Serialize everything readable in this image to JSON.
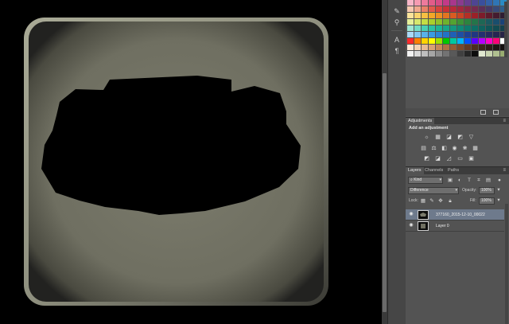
{
  "tools": [
    {
      "icon": "brush-icon",
      "glyph": "✎"
    },
    {
      "icon": "clone-stamp-icon",
      "glyph": "⚲"
    },
    {
      "icon": "text-icon",
      "glyph": "A"
    },
    {
      "icon": "paragraph-icon",
      "glyph": "¶"
    }
  ],
  "swatches": {
    "colors": [
      "#f7b6c8",
      "#f59bb2",
      "#ee7a9c",
      "#e25c89",
      "#d64b86",
      "#c33a88",
      "#a8378c",
      "#8a3b8e",
      "#6b3d8f",
      "#4e4593",
      "#3a4f9c",
      "#3461a8",
      "#2f75b5",
      "#2a8bc3",
      "#f6c9b0",
      "#f1a88e",
      "#ea8167",
      "#e25a4c",
      "#d7433c",
      "#c93136",
      "#b9293a",
      "#a4273f",
      "#8e2745",
      "#762a4f",
      "#5c3058",
      "#463a66",
      "#384a78",
      "#2d5e8c",
      "#fde39a",
      "#fbd36d",
      "#f7bf43",
      "#f2a727",
      "#ec8f22",
      "#e37421",
      "#d85b22",
      "#c84424",
      "#b32f26",
      "#9a2128",
      "#7d1c2a",
      "#5f1b2c",
      "#451c2f",
      "#2f1e33",
      "#e6f09a",
      "#d6e86e",
      "#c3dd45",
      "#a8cf2d",
      "#8dc12b",
      "#6fb22d",
      "#53a332",
      "#3b9337",
      "#2b843f",
      "#23754a",
      "#1e6755",
      "#1a5a61",
      "#194e6d",
      "#1a4378",
      "#9fe6d4",
      "#73dcc4",
      "#48cfb3",
      "#2ac1a2",
      "#1eb394",
      "#18a589",
      "#13977f",
      "#0f8976",
      "#0d7b6d",
      "#0d6e65",
      "#0e625e",
      "#105658",
      "#124b52",
      "#14414d",
      "#a9d8f5",
      "#82c6f0",
      "#59b1e9",
      "#3a9be0",
      "#2b86d4",
      "#2372c6",
      "#1f5fb6",
      "#1e4ea4",
      "#1f4192",
      "#213781",
      "#242f70",
      "#262a60",
      "#272652",
      "#272446",
      "#ff2a2a",
      "#ff7f00",
      "#ffd400",
      "#ffff00",
      "#9be000",
      "#00c800",
      "#00c8a0",
      "#00b4ff",
      "#0050ff",
      "#5a00ff",
      "#b400ff",
      "#ff00c8",
      "#ff0078",
      "#ffffff",
      "#ffe9d6",
      "#f4d2b3",
      "#e7ba93",
      "#d8a174",
      "#c58859",
      "#ad7044",
      "#935b35",
      "#7a482b",
      "#623925",
      "#4c2d20",
      "#3a241c",
      "#2b1c18",
      "#1f1614",
      "#141010",
      "#f2f2f2",
      "#d9d9d9",
      "#bfbfbf",
      "#a6a6a6",
      "#8c8c8c",
      "#737373",
      "#595959",
      "#404040",
      "#262626",
      "#0d0d0d",
      "#e0e8d0",
      "#c8d4b0",
      "#b0c090",
      "#98ac70"
    ]
  },
  "adjustments": {
    "tab": "Adjustments",
    "title": "Add an adjustment",
    "row1": [
      {
        "icon": "brightness-icon",
        "glyph": "☼"
      },
      {
        "icon": "levels-icon",
        "glyph": "▦"
      },
      {
        "icon": "curves-icon",
        "glyph": "◪"
      },
      {
        "icon": "exposure-icon",
        "glyph": "◩"
      },
      {
        "icon": "vibrance-icon",
        "glyph": "▽"
      }
    ],
    "row2": [
      {
        "icon": "hue-saturation-icon",
        "glyph": "▤"
      },
      {
        "icon": "color-balance-icon",
        "glyph": "⚖"
      },
      {
        "icon": "black-white-icon",
        "glyph": "◧"
      },
      {
        "icon": "photo-filter-icon",
        "glyph": "◉"
      },
      {
        "icon": "channel-mixer-icon",
        "glyph": "❀"
      },
      {
        "icon": "color-lookup-icon",
        "glyph": "▦"
      }
    ],
    "row3": [
      {
        "icon": "invert-icon",
        "glyph": "◩"
      },
      {
        "icon": "posterize-icon",
        "glyph": "◪"
      },
      {
        "icon": "threshold-icon",
        "glyph": "◿"
      },
      {
        "icon": "gradient-map-icon",
        "glyph": "▭"
      },
      {
        "icon": "selective-color-icon",
        "glyph": "▣"
      }
    ]
  },
  "layers_panel": {
    "tabs": [
      "Layers",
      "Channels",
      "Paths"
    ],
    "kind_label": "Kind",
    "blend_mode": "Difference",
    "opacity_label": "Opacity:",
    "opacity_value": "100%",
    "lock_label": "Lock:",
    "fill_label": "Fill:",
    "fill_value": "100%",
    "layers": [
      {
        "name": "377160_2015-12-10_00022",
        "selected": true
      },
      {
        "name": "Layer 0",
        "selected": false
      }
    ]
  },
  "colors": {
    "panel_bg": "#535353",
    "selection": "#6e7a8c",
    "canvas_tile": "#7b7b6c"
  }
}
